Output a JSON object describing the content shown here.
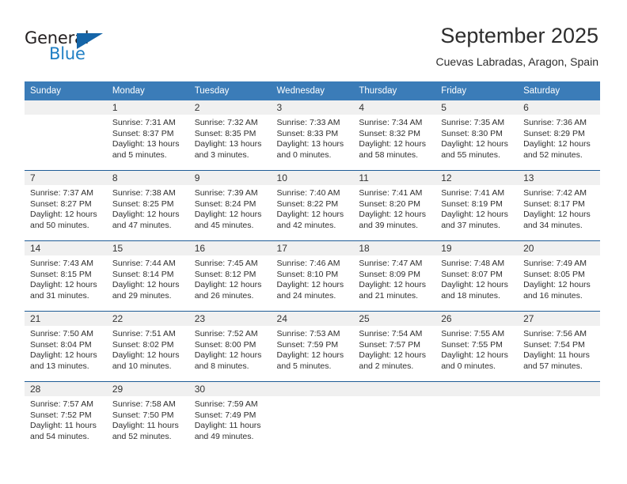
{
  "brand": {
    "name_top": "General",
    "name_bottom": "Blue",
    "accent_color": "#1f7fc4",
    "triangle_color": "#1565a8"
  },
  "header": {
    "title": "September 2025",
    "subtitle": "Cuevas Labradas, Aragon, Spain"
  },
  "calendar": {
    "header_bg": "#3b7cb8",
    "daynum_bg": "#f0f0f0",
    "weekdays": [
      "Sunday",
      "Monday",
      "Tuesday",
      "Wednesday",
      "Thursday",
      "Friday",
      "Saturday"
    ],
    "weeks": [
      [
        {
          "day": "",
          "sunrise": "",
          "sunset": "",
          "daylight1": "",
          "daylight2": ""
        },
        {
          "day": "1",
          "sunrise": "Sunrise: 7:31 AM",
          "sunset": "Sunset: 8:37 PM",
          "daylight1": "Daylight: 13 hours",
          "daylight2": "and 5 minutes."
        },
        {
          "day": "2",
          "sunrise": "Sunrise: 7:32 AM",
          "sunset": "Sunset: 8:35 PM",
          "daylight1": "Daylight: 13 hours",
          "daylight2": "and 3 minutes."
        },
        {
          "day": "3",
          "sunrise": "Sunrise: 7:33 AM",
          "sunset": "Sunset: 8:33 PM",
          "daylight1": "Daylight: 13 hours",
          "daylight2": "and 0 minutes."
        },
        {
          "day": "4",
          "sunrise": "Sunrise: 7:34 AM",
          "sunset": "Sunset: 8:32 PM",
          "daylight1": "Daylight: 12 hours",
          "daylight2": "and 58 minutes."
        },
        {
          "day": "5",
          "sunrise": "Sunrise: 7:35 AM",
          "sunset": "Sunset: 8:30 PM",
          "daylight1": "Daylight: 12 hours",
          "daylight2": "and 55 minutes."
        },
        {
          "day": "6",
          "sunrise": "Sunrise: 7:36 AM",
          "sunset": "Sunset: 8:29 PM",
          "daylight1": "Daylight: 12 hours",
          "daylight2": "and 52 minutes."
        }
      ],
      [
        {
          "day": "7",
          "sunrise": "Sunrise: 7:37 AM",
          "sunset": "Sunset: 8:27 PM",
          "daylight1": "Daylight: 12 hours",
          "daylight2": "and 50 minutes."
        },
        {
          "day": "8",
          "sunrise": "Sunrise: 7:38 AM",
          "sunset": "Sunset: 8:25 PM",
          "daylight1": "Daylight: 12 hours",
          "daylight2": "and 47 minutes."
        },
        {
          "day": "9",
          "sunrise": "Sunrise: 7:39 AM",
          "sunset": "Sunset: 8:24 PM",
          "daylight1": "Daylight: 12 hours",
          "daylight2": "and 45 minutes."
        },
        {
          "day": "10",
          "sunrise": "Sunrise: 7:40 AM",
          "sunset": "Sunset: 8:22 PM",
          "daylight1": "Daylight: 12 hours",
          "daylight2": "and 42 minutes."
        },
        {
          "day": "11",
          "sunrise": "Sunrise: 7:41 AM",
          "sunset": "Sunset: 8:20 PM",
          "daylight1": "Daylight: 12 hours",
          "daylight2": "and 39 minutes."
        },
        {
          "day": "12",
          "sunrise": "Sunrise: 7:41 AM",
          "sunset": "Sunset: 8:19 PM",
          "daylight1": "Daylight: 12 hours",
          "daylight2": "and 37 minutes."
        },
        {
          "day": "13",
          "sunrise": "Sunrise: 7:42 AM",
          "sunset": "Sunset: 8:17 PM",
          "daylight1": "Daylight: 12 hours",
          "daylight2": "and 34 minutes."
        }
      ],
      [
        {
          "day": "14",
          "sunrise": "Sunrise: 7:43 AM",
          "sunset": "Sunset: 8:15 PM",
          "daylight1": "Daylight: 12 hours",
          "daylight2": "and 31 minutes."
        },
        {
          "day": "15",
          "sunrise": "Sunrise: 7:44 AM",
          "sunset": "Sunset: 8:14 PM",
          "daylight1": "Daylight: 12 hours",
          "daylight2": "and 29 minutes."
        },
        {
          "day": "16",
          "sunrise": "Sunrise: 7:45 AM",
          "sunset": "Sunset: 8:12 PM",
          "daylight1": "Daylight: 12 hours",
          "daylight2": "and 26 minutes."
        },
        {
          "day": "17",
          "sunrise": "Sunrise: 7:46 AM",
          "sunset": "Sunset: 8:10 PM",
          "daylight1": "Daylight: 12 hours",
          "daylight2": "and 24 minutes."
        },
        {
          "day": "18",
          "sunrise": "Sunrise: 7:47 AM",
          "sunset": "Sunset: 8:09 PM",
          "daylight1": "Daylight: 12 hours",
          "daylight2": "and 21 minutes."
        },
        {
          "day": "19",
          "sunrise": "Sunrise: 7:48 AM",
          "sunset": "Sunset: 8:07 PM",
          "daylight1": "Daylight: 12 hours",
          "daylight2": "and 18 minutes."
        },
        {
          "day": "20",
          "sunrise": "Sunrise: 7:49 AM",
          "sunset": "Sunset: 8:05 PM",
          "daylight1": "Daylight: 12 hours",
          "daylight2": "and 16 minutes."
        }
      ],
      [
        {
          "day": "21",
          "sunrise": "Sunrise: 7:50 AM",
          "sunset": "Sunset: 8:04 PM",
          "daylight1": "Daylight: 12 hours",
          "daylight2": "and 13 minutes."
        },
        {
          "day": "22",
          "sunrise": "Sunrise: 7:51 AM",
          "sunset": "Sunset: 8:02 PM",
          "daylight1": "Daylight: 12 hours",
          "daylight2": "and 10 minutes."
        },
        {
          "day": "23",
          "sunrise": "Sunrise: 7:52 AM",
          "sunset": "Sunset: 8:00 PM",
          "daylight1": "Daylight: 12 hours",
          "daylight2": "and 8 minutes."
        },
        {
          "day": "24",
          "sunrise": "Sunrise: 7:53 AM",
          "sunset": "Sunset: 7:59 PM",
          "daylight1": "Daylight: 12 hours",
          "daylight2": "and 5 minutes."
        },
        {
          "day": "25",
          "sunrise": "Sunrise: 7:54 AM",
          "sunset": "Sunset: 7:57 PM",
          "daylight1": "Daylight: 12 hours",
          "daylight2": "and 2 minutes."
        },
        {
          "day": "26",
          "sunrise": "Sunrise: 7:55 AM",
          "sunset": "Sunset: 7:55 PM",
          "daylight1": "Daylight: 12 hours",
          "daylight2": "and 0 minutes."
        },
        {
          "day": "27",
          "sunrise": "Sunrise: 7:56 AM",
          "sunset": "Sunset: 7:54 PM",
          "daylight1": "Daylight: 11 hours",
          "daylight2": "and 57 minutes."
        }
      ],
      [
        {
          "day": "28",
          "sunrise": "Sunrise: 7:57 AM",
          "sunset": "Sunset: 7:52 PM",
          "daylight1": "Daylight: 11 hours",
          "daylight2": "and 54 minutes."
        },
        {
          "day": "29",
          "sunrise": "Sunrise: 7:58 AM",
          "sunset": "Sunset: 7:50 PM",
          "daylight1": "Daylight: 11 hours",
          "daylight2": "and 52 minutes."
        },
        {
          "day": "30",
          "sunrise": "Sunrise: 7:59 AM",
          "sunset": "Sunset: 7:49 PM",
          "daylight1": "Daylight: 11 hours",
          "daylight2": "and 49 minutes."
        },
        {
          "day": "",
          "sunrise": "",
          "sunset": "",
          "daylight1": "",
          "daylight2": ""
        },
        {
          "day": "",
          "sunrise": "",
          "sunset": "",
          "daylight1": "",
          "daylight2": ""
        },
        {
          "day": "",
          "sunrise": "",
          "sunset": "",
          "daylight1": "",
          "daylight2": ""
        },
        {
          "day": "",
          "sunrise": "",
          "sunset": "",
          "daylight1": "",
          "daylight2": ""
        }
      ]
    ]
  }
}
